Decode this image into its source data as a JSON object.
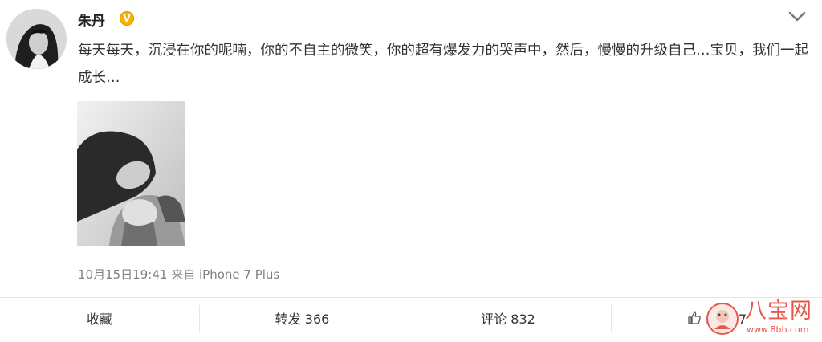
{
  "author": {
    "name": "朱丹",
    "verified_badge": "V"
  },
  "post": {
    "text": "每天每天，沉浸在你的呢喃，你的不自主的微笑，你的超有爆发力的哭声中，然后，慢慢的升级自己…宝贝，我们一起成长…"
  },
  "meta": {
    "time": "10月15日19:41",
    "source_prefix": "来自",
    "source": "iPhone 7 Plus"
  },
  "actions": {
    "favorite": "收藏",
    "repost_label": "转发",
    "repost_count": "366",
    "comment_label": "评论",
    "comment_count": "832",
    "like_count": "34317"
  },
  "watermark": {
    "title": "八宝网",
    "url": "www.8bb.com"
  },
  "icons": {
    "expand": "chevron-down-icon",
    "like": "thumbs-up-icon",
    "verified": "verified-v-icon"
  },
  "colors": {
    "badge": "#f7b100",
    "watermark": "#e8584a",
    "text": "#333333",
    "meta": "#808080"
  }
}
